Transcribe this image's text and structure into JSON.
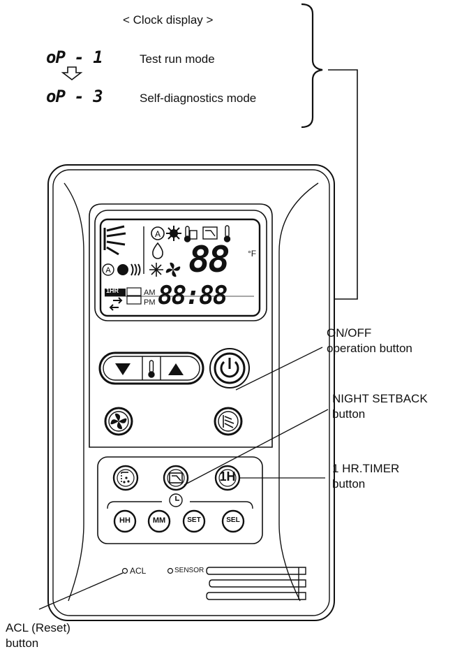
{
  "header": {
    "clock_display": "< Clock display >",
    "test_run_code": "oP - 1",
    "test_run_label": "Test run mode",
    "self_diag_code": "oP - 3",
    "self_diag_label": "Self-diagnostics mode"
  },
  "callouts": {
    "on_off_line1": "ON/OFF",
    "on_off_line2": "operation button",
    "night_line1": "NIGHT SETBACK",
    "night_line2": "button",
    "timer_line1": "1 HR.TIMER",
    "timer_line2": "button",
    "acl_line1": "ACL (Reset)",
    "acl_line2": "button"
  },
  "lcd": {
    "temp_digits": "88",
    "unit": "°F",
    "time_digits": "88:88",
    "am": "AM",
    "pm": "PM",
    "one_hr": "1HR"
  },
  "buttons": {
    "one_h": "1H",
    "hh": "HH",
    "mm": "MM",
    "set": "SET",
    "sel": "SEL"
  },
  "bottom": {
    "acl": "ACL",
    "sensor": "SENSOR"
  }
}
